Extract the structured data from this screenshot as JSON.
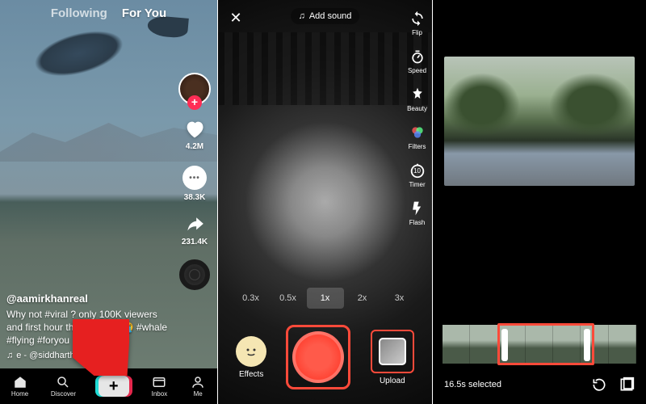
{
  "panel1": {
    "tabs": {
      "following": "Following",
      "for_you": "For You"
    },
    "rail": {
      "likes": "4.2M",
      "comments": "38.3K",
      "shares": "231.4K"
    },
    "caption": {
      "username": "@aamirkhanreal",
      "text": "Why not #viral ? only 100K viewers and first hour then stopped😭 #whale #flying #foryou",
      "sound_prefix": "♫",
      "sound": "e - @siddharth🇮🇳    orig"
    },
    "nav": {
      "home": "Home",
      "discover": "Discover",
      "inbox": "Inbox",
      "me": "Me"
    }
  },
  "panel2": {
    "add_sound": "Add sound",
    "tools": {
      "flip": "Flip",
      "speed": "Speed",
      "beauty": "Beauty",
      "filters": "Filters",
      "timer": "Timer",
      "flash": "Flash"
    },
    "timer_value": "10",
    "zoom": [
      "0.3x",
      "0.5x",
      "1x",
      "2x",
      "3x"
    ],
    "zoom_active_index": 2,
    "effects": "Effects",
    "upload": "Upload"
  },
  "panel3": {
    "selected_label": "16.5s selected"
  }
}
